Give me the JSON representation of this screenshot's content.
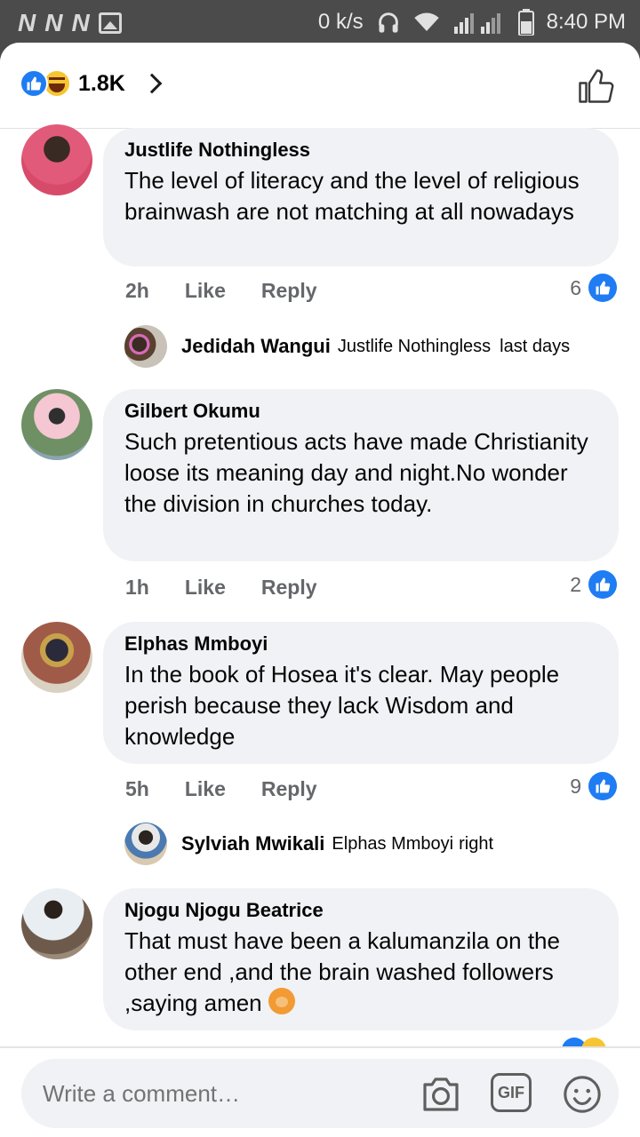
{
  "status_bar": {
    "network_speed": "0 k/s",
    "time": "8:40 PM",
    "left_icons": [
      "N",
      "N",
      "N"
    ]
  },
  "header": {
    "reaction_count": "1.8K",
    "reactions": [
      "like-icon",
      "haha-icon"
    ]
  },
  "comments": [
    {
      "author": "Justlife Nothingless",
      "text": "The level of literacy and the level of religious brainwash are not matching at all nowadays",
      "time": "2h",
      "like_label": "Like",
      "reply_label": "Reply",
      "reaction_count": "6",
      "reply": {
        "author": "Jedidah Wangui",
        "mention": "Justlife Nothingless",
        "text": "last days"
      }
    },
    {
      "author": "Gilbert Okumu",
      "text": "Such pretentious acts have made Christianity loose its meaning day and night.No wonder the division in churches today.",
      "time": "1h",
      "like_label": "Like",
      "reply_label": "Reply",
      "reaction_count": "2"
    },
    {
      "author": "Elphas Mmboyi",
      "text": "In the book of Hosea it's clear. May people perish because they lack Wisdom and knowledge",
      "time": "5h",
      "like_label": "Like",
      "reply_label": "Reply",
      "reaction_count": "9",
      "reply": {
        "author": "Sylviah Mwikali",
        "mention": "Elphas Mmboyi",
        "text": "right"
      }
    },
    {
      "author": "Njogu Njogu Beatrice",
      "text": "That must have been a kalumanzila on the other end ,and the brain washed followers ,saying amen"
    }
  ],
  "composer": {
    "placeholder": "Write a comment…",
    "gif_label": "GIF"
  },
  "colors": {
    "accent": "#1f7cf2",
    "bubble": "#f0f2f5",
    "meta_text": "#65676b"
  }
}
